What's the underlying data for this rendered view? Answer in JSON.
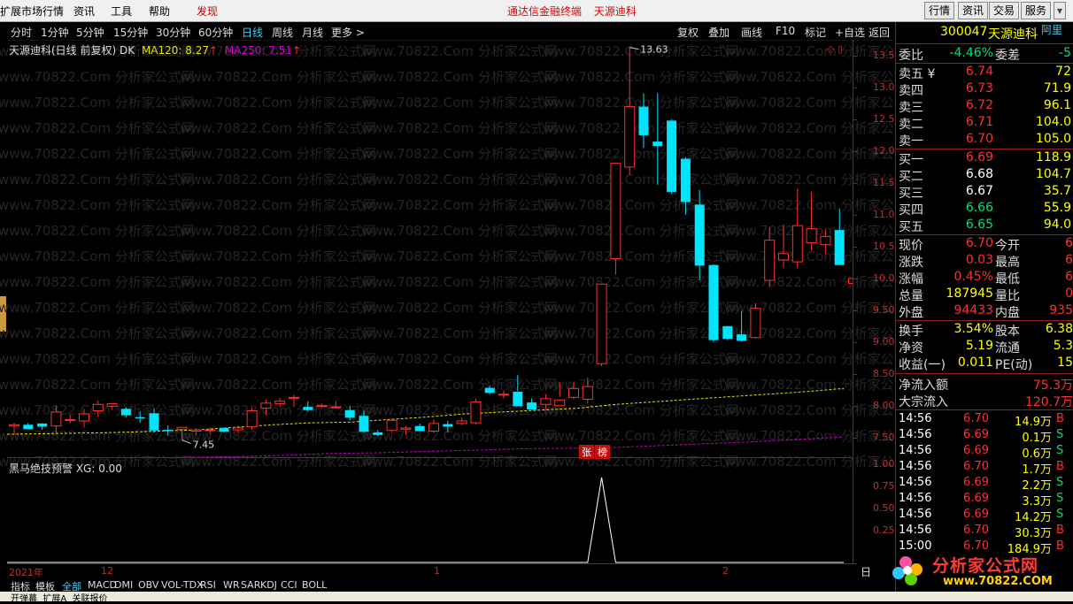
{
  "menubar": {
    "items": [
      "扩展市场行情",
      "资讯",
      "工具",
      "帮助",
      "发现"
    ],
    "center": [
      "通达信金融终端",
      "天源迪科"
    ],
    "right_buttons": [
      "行情",
      "资讯",
      "交易",
      "服务"
    ]
  },
  "toolbar": {
    "periods": [
      "分时",
      "1分钟",
      "5分钟",
      "15分钟",
      "30分钟",
      "60分钟",
      "日线",
      "周线",
      "月线",
      "更多 >"
    ],
    "active": "日线",
    "actions": [
      "复权",
      "叠加",
      "画线",
      "F10",
      "标记",
      "+自选",
      "返回"
    ]
  },
  "main_chart": {
    "title": "天源迪科(日线 前复权) DK",
    "ma120_label": "MA120: 8.27",
    "ma250_label": "MA250: 7.51",
    "high_label": "13.63",
    "low_label": "7.45",
    "y_ticks": [
      "13.50",
      "13.00",
      "12.50",
      "12.00",
      "11.50",
      "11.00",
      "10.50",
      "10.00",
      "9.50",
      "9.00",
      "8.50",
      "8.00",
      "7.50"
    ],
    "badge_zhang": "张",
    "badge_bang": "榜",
    "watermark": "www.70822.Com 分析家公式网",
    "colors": {
      "up": "#ff3030",
      "down": "#00e5ff",
      "ma120": "#e8e000",
      "ma250": "#c000c0",
      "axis": "#8b1e1e"
    }
  },
  "sub_chart": {
    "title": "黑马绝技预警 XG: 0.00",
    "y_ticks": [
      "1.00",
      "0.75",
      "0.50",
      "0.25"
    ]
  },
  "date_bar": {
    "labels": [
      "2021年",
      "12",
      "1",
      "2"
    ],
    "period_button": "日线"
  },
  "tabs": [
    "指标",
    "模板",
    "全部",
    "MACD",
    "DMI",
    "OBV",
    "VOL-TDX",
    "RSI",
    "WR",
    "SAR",
    "KDJ",
    "CCI",
    "BOLL"
  ],
  "active_tab": "全部",
  "status_bar": "开弹幕  扩展A  关联报价",
  "panel": {
    "code": "300047",
    "name": "天源迪科",
    "tag": "阿里",
    "weibi_label": "委比",
    "weibi_value": "-4.46%",
    "weicha_label": "委差",
    "weicha_value": "-5",
    "asks": [
      {
        "label": "卖五 ¥",
        "price": "6.74",
        "vol": "72"
      },
      {
        "label": "卖四",
        "price": "6.73",
        "vol": "71.9"
      },
      {
        "label": "卖三",
        "price": "6.72",
        "vol": "96.1"
      },
      {
        "label": "卖二",
        "price": "6.71",
        "vol": "104.0"
      },
      {
        "label": "卖一",
        "price": "6.70",
        "vol": "105.0"
      }
    ],
    "bids": [
      {
        "label": "买一",
        "price": "6.69",
        "vol": "118.9"
      },
      {
        "label": "买二",
        "price": "6.68",
        "vol": "104.7"
      },
      {
        "label": "买三",
        "price": "6.67",
        "vol": "35.7"
      },
      {
        "label": "买四",
        "price": "6.66",
        "vol": "55.9"
      },
      {
        "label": "买五",
        "price": "6.65",
        "vol": "94.0"
      }
    ],
    "stats": [
      {
        "l1": "现价",
        "v1": "6.70",
        "c1": "red",
        "l2": "今开",
        "v2": "6"
      },
      {
        "l1": "涨跌",
        "v1": "0.03",
        "c1": "red",
        "l2": "最高",
        "v2": "6"
      },
      {
        "l1": "涨幅",
        "v1": "0.45%",
        "c1": "red",
        "l2": "最低",
        "v2": "6"
      },
      {
        "l1": "总量",
        "v1": "187945",
        "c1": "yellow",
        "l2": "量比",
        "v2": "0"
      },
      {
        "l1": "外盘",
        "v1": "94433",
        "c1": "red",
        "l2": "内盘",
        "v2": "935"
      }
    ],
    "stats2": [
      {
        "l1": "换手",
        "v1": "3.54%",
        "l2": "股本",
        "v2": "6.38"
      },
      {
        "l1": "净资",
        "v1": "5.19",
        "l2": "流通",
        "v2": "5.3"
      },
      {
        "l1": "收益(一)",
        "v1": "0.011",
        "l2": "PE(动)",
        "v2": "15"
      }
    ],
    "flows": [
      {
        "label": "净流入额",
        "value": "75.3万"
      },
      {
        "label": "大宗流入",
        "value": "120.7万"
      }
    ],
    "ticks": [
      {
        "time": "14:56",
        "price": "6.70",
        "vol": "14.9万",
        "side": "B"
      },
      {
        "time": "14:56",
        "price": "6.69",
        "vol": "0.1万",
        "side": "S"
      },
      {
        "time": "14:56",
        "price": "6.69",
        "vol": "0.6万",
        "side": "S"
      },
      {
        "time": "14:56",
        "price": "6.70",
        "vol": "1.7万",
        "side": "B"
      },
      {
        "time": "14:56",
        "price": "6.69",
        "vol": "2.2万",
        "side": "S"
      },
      {
        "time": "14:56",
        "price": "6.69",
        "vol": "3.3万",
        "side": "S"
      },
      {
        "time": "14:56",
        "price": "6.69",
        "vol": "14.2万",
        "side": "S"
      },
      {
        "time": "14:56",
        "price": "6.70",
        "vol": "30.3万",
        "side": "B"
      },
      {
        "time": "15:00",
        "price": "6.70",
        "vol": "184.9万",
        "side": "B"
      }
    ]
  },
  "logo": {
    "text": "分析家公式网",
    "url_text": "www.70822.COM"
  },
  "chart_data": {
    "type": "candlestick",
    "ohlc": [
      [
        7.68,
        7.73,
        7.55,
        7.7
      ],
      [
        7.7,
        7.73,
        7.63,
        7.63
      ],
      [
        7.72,
        7.72,
        7.62,
        7.67
      ],
      [
        7.68,
        8.0,
        7.56,
        7.9
      ],
      [
        7.78,
        7.85,
        7.72,
        7.78
      ],
      [
        7.76,
        7.95,
        7.66,
        7.87
      ],
      [
        7.92,
        8.08,
        7.83,
        8.02
      ],
      [
        7.99,
        8.04,
        7.94,
        8.03
      ],
      [
        7.95,
        7.97,
        7.82,
        7.85
      ],
      [
        7.82,
        7.91,
        7.73,
        7.8
      ],
      [
        7.88,
        7.96,
        7.58,
        7.61
      ],
      [
        7.62,
        7.69,
        7.53,
        7.6
      ],
      [
        7.63,
        7.66,
        7.46,
        7.66
      ],
      [
        7.6,
        7.65,
        7.54,
        7.62
      ],
      [
        7.62,
        7.66,
        7.55,
        7.62
      ],
      [
        7.65,
        7.65,
        7.58,
        7.59
      ],
      [
        7.62,
        7.68,
        7.58,
        7.65
      ],
      [
        7.67,
        7.97,
        7.62,
        7.92
      ],
      [
        7.96,
        8.1,
        7.85,
        8.04
      ],
      [
        8.03,
        8.12,
        7.98,
        8.07
      ],
      [
        8.12,
        8.17,
        7.98,
        8.13
      ],
      [
        7.98,
        8.07,
        7.9,
        7.93
      ],
      [
        7.99,
        8.03,
        7.97,
        8.0
      ],
      [
        7.97,
        8.07,
        7.95,
        7.98
      ],
      [
        7.93,
        8.0,
        7.77,
        7.81
      ],
      [
        7.84,
        7.92,
        7.58,
        7.59
      ],
      [
        7.58,
        7.62,
        7.52,
        7.54
      ],
      [
        7.61,
        7.79,
        7.58,
        7.77
      ],
      [
        7.63,
        7.68,
        7.54,
        7.65
      ],
      [
        7.68,
        7.72,
        7.6,
        7.6
      ],
      [
        7.6,
        7.78,
        7.57,
        7.72
      ],
      [
        7.71,
        7.76,
        7.58,
        7.67
      ],
      [
        7.72,
        7.81,
        7.69,
        7.76
      ],
      [
        7.73,
        8.11,
        7.7,
        8.06
      ],
      [
        8.28,
        8.32,
        8.18,
        8.2
      ],
      [
        8.18,
        8.24,
        8.11,
        8.18
      ],
      [
        8.22,
        8.48,
        8.23,
        7.99
      ],
      [
        8.05,
        8.11,
        7.94,
        7.94
      ],
      [
        8.02,
        8.18,
        7.93,
        8.11
      ],
      [
        8.0,
        8.36,
        8.14,
        8.09
      ],
      [
        8.13,
        8.38,
        8.1,
        8.27
      ],
      [
        8.1,
        8.44,
        8.03,
        8.3
      ],
      [
        8.66,
        9.91,
        8.62,
        9.91
      ],
      [
        10.31,
        11.81,
        10.06,
        11.81
      ],
      [
        11.75,
        13.63,
        11.63,
        12.7
      ],
      [
        12.7,
        12.91,
        12.05,
        12.25
      ],
      [
        12.15,
        12.91,
        11.47,
        12.08
      ],
      [
        12.48,
        12.5,
        11.33,
        11.36
      ],
      [
        11.88,
        11.91,
        11.0,
        11.2
      ],
      [
        11.16,
        11.39,
        9.97,
        10.2
      ],
      [
        10.21,
        10.22,
        9.0,
        9.03
      ],
      [
        9.25,
        9.25,
        9.03,
        9.05
      ],
      [
        9.12,
        9.49,
        9.01,
        9.02
      ],
      [
        9.07,
        9.61,
        9.05,
        9.53
      ],
      [
        9.97,
        10.81,
        9.86,
        10.6
      ],
      [
        10.29,
        10.85,
        10.16,
        10.39
      ],
      [
        10.26,
        11.41,
        10.16,
        10.83
      ],
      [
        10.56,
        11.36,
        10.44,
        10.78
      ],
      [
        10.53,
        10.76,
        10.39,
        10.66
      ],
      [
        10.76,
        11.1,
        10.42,
        10.21
      ],
      [
        9.92,
        10.41,
        9.75,
        10.0
      ]
    ],
    "ma120": [
      7.55,
      7.56,
      7.57,
      7.58,
      7.6,
      7.62,
      7.66,
      7.7,
      7.73,
      7.74,
      7.78,
      7.82,
      7.87,
      7.9,
      7.93,
      7.96,
      8.02,
      8.06,
      8.1,
      8.14,
      8.18,
      8.22,
      8.27
    ],
    "ma250": [
      7.16,
      7.16,
      7.17,
      7.18,
      7.19,
      7.2,
      7.22,
      7.25,
      7.26,
      7.28,
      7.3,
      7.32,
      7.33,
      7.34,
      7.37,
      7.4,
      7.43,
      7.47,
      7.51
    ],
    "ylim": [
      7.19,
      13.75
    ],
    "xg_signal_index": 42,
    "xg_ylim": [
      0,
      1
    ]
  }
}
